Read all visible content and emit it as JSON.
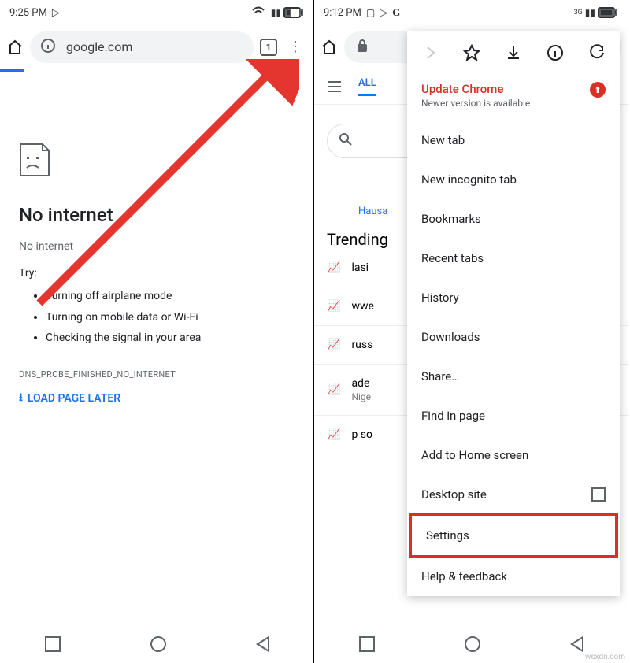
{
  "left": {
    "status_time": "9:25 PM",
    "url": "google.com",
    "tab_count": "1",
    "heading": "No internet",
    "sub": "No internet",
    "try_label": "Try:",
    "tips": [
      "Turning off airplane mode",
      "Turning on mobile data or Wi-Fi",
      "Checking the signal in your area"
    ],
    "dns": "DNS_PROBE_FINISHED_NO_INTERNET",
    "load_later": "LOAD PAGE LATER"
  },
  "right": {
    "status_time": "9:12 PM",
    "tab_all": "ALL",
    "lang": "Hausa",
    "trending_label": "Trending",
    "trends": [
      {
        "t": "lasi"
      },
      {
        "t": "wwe"
      },
      {
        "t": "russ"
      },
      {
        "t": "ade",
        "s": "Nige"
      },
      {
        "t": "p so"
      }
    ],
    "menu": {
      "update_title": "Update Chrome",
      "update_sub": "Newer version is available",
      "items": [
        "New tab",
        "New incognito tab",
        "Bookmarks",
        "Recent tabs",
        "History",
        "Downloads",
        "Share…",
        "Find in page",
        "Add to Home screen",
        "Desktop site",
        "Settings",
        "Help & feedback"
      ]
    },
    "network": "3G"
  },
  "watermark": "wsxdn.com"
}
